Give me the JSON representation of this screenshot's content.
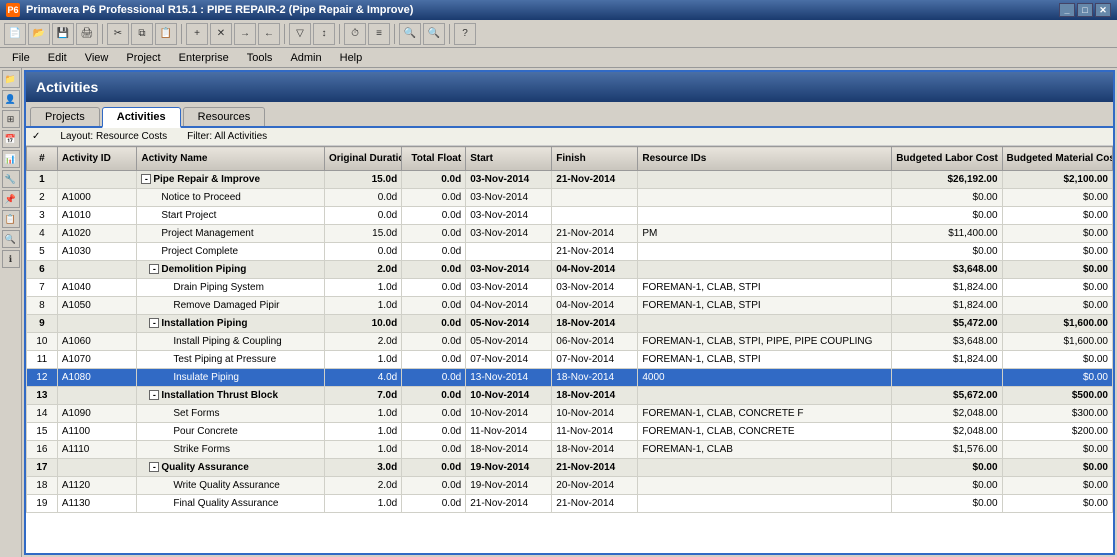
{
  "titleBar": {
    "title": "Primavera P6 Professional R15.1 : PIPE REPAIR-2 (Pipe Repair & Improve)",
    "icon": "P6"
  },
  "menuBar": {
    "items": [
      "File",
      "Edit",
      "View",
      "Project",
      "Enterprise",
      "Tools",
      "Admin",
      "Help"
    ]
  },
  "header": {
    "title": "Activities"
  },
  "tabs": [
    {
      "label": "Projects",
      "active": false
    },
    {
      "label": "Activities",
      "active": true
    },
    {
      "label": "Resources",
      "active": false
    }
  ],
  "filterBar": {
    "layout": "Layout: Resource Costs",
    "filter": "Filter: All Activities"
  },
  "tableHeaders": [
    "#",
    "Activity ID",
    "Activity Name",
    "Original Duration",
    "Total Float",
    "Start",
    "Finish",
    "Resource IDs",
    "Budgeted Labor Cost",
    "Budgeted Material Cost"
  ],
  "rows": [
    {
      "num": "1",
      "actid": "",
      "actname": "Pipe Repair & Improve",
      "origdur": "15.0d",
      "totalfloat": "0.0d",
      "start": "03-Nov-2014",
      "finish": "21-Nov-2014",
      "resources": "",
      "budlabor": "$26,192.00",
      "budmat": "$2,100.00",
      "level": 0,
      "type": "group",
      "expanded": true
    },
    {
      "num": "2",
      "actid": "A1000",
      "actname": "Notice to Proceed",
      "origdur": "0.0d",
      "totalfloat": "0.0d",
      "start": "03-Nov-2014",
      "finish": "",
      "resources": "",
      "budlabor": "$0.00",
      "budmat": "$0.00",
      "level": 1
    },
    {
      "num": "3",
      "actid": "A1010",
      "actname": "Start Project",
      "origdur": "0.0d",
      "totalfloat": "0.0d",
      "start": "03-Nov-2014",
      "finish": "",
      "resources": "",
      "budlabor": "$0.00",
      "budmat": "$0.00",
      "level": 1
    },
    {
      "num": "4",
      "actid": "A1020",
      "actname": "Project Management",
      "origdur": "15.0d",
      "totalfloat": "0.0d",
      "start": "03-Nov-2014",
      "finish": "21-Nov-2014",
      "resources": "PM",
      "budlabor": "$11,400.00",
      "budmat": "$0.00",
      "level": 1
    },
    {
      "num": "5",
      "actid": "A1030",
      "actname": "Project Complete",
      "origdur": "0.0d",
      "totalfloat": "0.0d",
      "start": "",
      "finish": "21-Nov-2014",
      "resources": "",
      "budlabor": "$0.00",
      "budmat": "$0.00",
      "level": 1
    },
    {
      "num": "6",
      "actid": "",
      "actname": "Demolition Piping",
      "origdur": "2.0d",
      "totalfloat": "0.0d",
      "start": "03-Nov-2014",
      "finish": "04-Nov-2014",
      "resources": "",
      "budlabor": "$3,648.00",
      "budmat": "$0.00",
      "level": 1,
      "type": "group",
      "expanded": true
    },
    {
      "num": "7",
      "actid": "A1040",
      "actname": "Drain Piping System",
      "origdur": "1.0d",
      "totalfloat": "0.0d",
      "start": "03-Nov-2014",
      "finish": "03-Nov-2014",
      "resources": "FOREMAN-1, CLAB, STPI",
      "budlabor": "$1,824.00",
      "budmat": "$0.00",
      "level": 2
    },
    {
      "num": "8",
      "actid": "A1050",
      "actname": "Remove Damaged Pipir",
      "origdur": "1.0d",
      "totalfloat": "0.0d",
      "start": "04-Nov-2014",
      "finish": "04-Nov-2014",
      "resources": "FOREMAN-1, CLAB, STPI",
      "budlabor": "$1,824.00",
      "budmat": "$0.00",
      "level": 2
    },
    {
      "num": "9",
      "actid": "",
      "actname": "Installation Piping",
      "origdur": "10.0d",
      "totalfloat": "0.0d",
      "start": "05-Nov-2014",
      "finish": "18-Nov-2014",
      "resources": "",
      "budlabor": "$5,472.00",
      "budmat": "$1,600.00",
      "level": 1,
      "type": "group",
      "expanded": true
    },
    {
      "num": "10",
      "actid": "A1060",
      "actname": "Install Piping & Coupling",
      "origdur": "2.0d",
      "totalfloat": "0.0d",
      "start": "05-Nov-2014",
      "finish": "06-Nov-2014",
      "resources": "FOREMAN-1, CLAB, STPI, PIPE, PIPE COUPLING",
      "budlabor": "$3,648.00",
      "budmat": "$1,600.00",
      "level": 2
    },
    {
      "num": "11",
      "actid": "A1070",
      "actname": "Test Piping at Pressure",
      "origdur": "1.0d",
      "totalfloat": "0.0d",
      "start": "07-Nov-2014",
      "finish": "07-Nov-2014",
      "resources": "FOREMAN-1, CLAB, STPI",
      "budlabor": "$1,824.00",
      "budmat": "$0.00",
      "level": 2
    },
    {
      "num": "12",
      "actid": "A1080",
      "actname": "Insulate Piping",
      "origdur": "4.0d",
      "totalfloat": "0.0d",
      "start": "13-Nov-2014",
      "finish": "18-Nov-2014",
      "resources": "4000",
      "budlabor": "",
      "budmat": "$0.00",
      "level": 2,
      "selected": true
    },
    {
      "num": "13",
      "actid": "",
      "actname": "Installation Thrust Block",
      "origdur": "7.0d",
      "totalfloat": "0.0d",
      "start": "10-Nov-2014",
      "finish": "18-Nov-2014",
      "resources": "",
      "budlabor": "$5,672.00",
      "budmat": "$500.00",
      "level": 1,
      "type": "group",
      "expanded": true
    },
    {
      "num": "14",
      "actid": "A1090",
      "actname": "Set Forms",
      "origdur": "1.0d",
      "totalfloat": "0.0d",
      "start": "10-Nov-2014",
      "finish": "10-Nov-2014",
      "resources": "FOREMAN-1, CLAB, CONCRETE F",
      "budlabor": "$2,048.00",
      "budmat": "$300.00",
      "level": 2
    },
    {
      "num": "15",
      "actid": "A1100",
      "actname": "Pour Concrete",
      "origdur": "1.0d",
      "totalfloat": "0.0d",
      "start": "11-Nov-2014",
      "finish": "11-Nov-2014",
      "resources": "FOREMAN-1, CLAB, CONCRETE",
      "budlabor": "$2,048.00",
      "budmat": "$200.00",
      "level": 2
    },
    {
      "num": "16",
      "actid": "A1110",
      "actname": "Strike Forms",
      "origdur": "1.0d",
      "totalfloat": "0.0d",
      "start": "18-Nov-2014",
      "finish": "18-Nov-2014",
      "resources": "FOREMAN-1, CLAB",
      "budlabor": "$1,576.00",
      "budmat": "$0.00",
      "level": 2
    },
    {
      "num": "17",
      "actid": "",
      "actname": "Quality Assurance",
      "origdur": "3.0d",
      "totalfloat": "0.0d",
      "start": "19-Nov-2014",
      "finish": "21-Nov-2014",
      "resources": "",
      "budlabor": "$0.00",
      "budmat": "$0.00",
      "level": 1,
      "type": "group",
      "expanded": true
    },
    {
      "num": "18",
      "actid": "A1120",
      "actname": "Write Quality Assurance",
      "origdur": "2.0d",
      "totalfloat": "0.0d",
      "start": "19-Nov-2014",
      "finish": "20-Nov-2014",
      "resources": "",
      "budlabor": "$0.00",
      "budmat": "$0.00",
      "level": 2
    },
    {
      "num": "19",
      "actid": "A1130",
      "actname": "Final Quality Assurance",
      "origdur": "1.0d",
      "totalfloat": "0.0d",
      "start": "21-Nov-2014",
      "finish": "21-Nov-2014",
      "resources": "",
      "budlabor": "$0.00",
      "budmat": "$0.00",
      "level": 2
    }
  ],
  "sidebarIcons": [
    "folder",
    "person",
    "grid",
    "calendar",
    "chart",
    "wrench",
    "pin",
    "clipboard",
    "magnify",
    "info"
  ]
}
